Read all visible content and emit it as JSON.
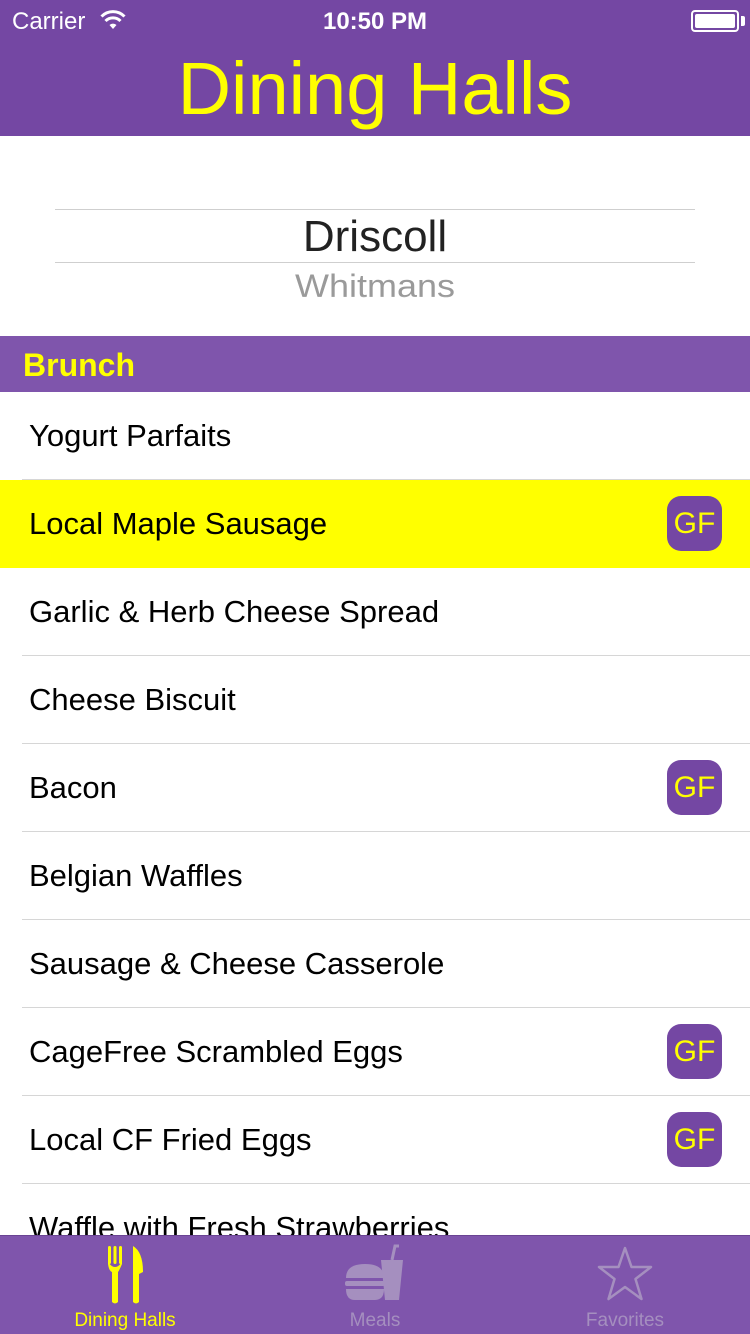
{
  "status_bar": {
    "carrier": "Carrier",
    "time": "10:50 PM",
    "battery_level": 1.0
  },
  "app_title": "Dining Halls",
  "hall_picker": {
    "selected": "Driscoll",
    "next": "Whitmans"
  },
  "section": {
    "title": "Brunch"
  },
  "menu_items": [
    {
      "name": "Yogurt Parfaits",
      "badge": "",
      "highlighted": false
    },
    {
      "name": "Local Maple Sausage",
      "badge": "GF",
      "highlighted": true
    },
    {
      "name": "Garlic & Herb Cheese Spread",
      "badge": "",
      "highlighted": false
    },
    {
      "name": "Cheese Biscuit",
      "badge": "",
      "highlighted": false
    },
    {
      "name": "Bacon",
      "badge": "GF",
      "highlighted": false
    },
    {
      "name": "Belgian Waffles",
      "badge": "",
      "highlighted": false
    },
    {
      "name": "Sausage & Cheese Casserole",
      "badge": "",
      "highlighted": false
    },
    {
      "name": "CageFree Scrambled Eggs",
      "badge": "GF",
      "highlighted": false
    },
    {
      "name": "Local CF Fried Eggs",
      "badge": "GF",
      "highlighted": false
    },
    {
      "name": "Waffle with Fresh Strawberries",
      "badge": "",
      "highlighted": false
    }
  ],
  "tab_bar": {
    "tabs": [
      {
        "label": "Dining Halls",
        "icon": "fork-knife-icon",
        "active": true
      },
      {
        "label": "Meals",
        "icon": "burger-drink-icon",
        "active": false
      },
      {
        "label": "Favorites",
        "icon": "star-icon",
        "active": false
      }
    ]
  },
  "colors": {
    "brand_purple": "#7447a3",
    "section_purple": "#7f55ac",
    "accent_yellow": "#ffff00",
    "highlight_row": "#ffff00",
    "inactive_tab": "#a58fbf"
  }
}
